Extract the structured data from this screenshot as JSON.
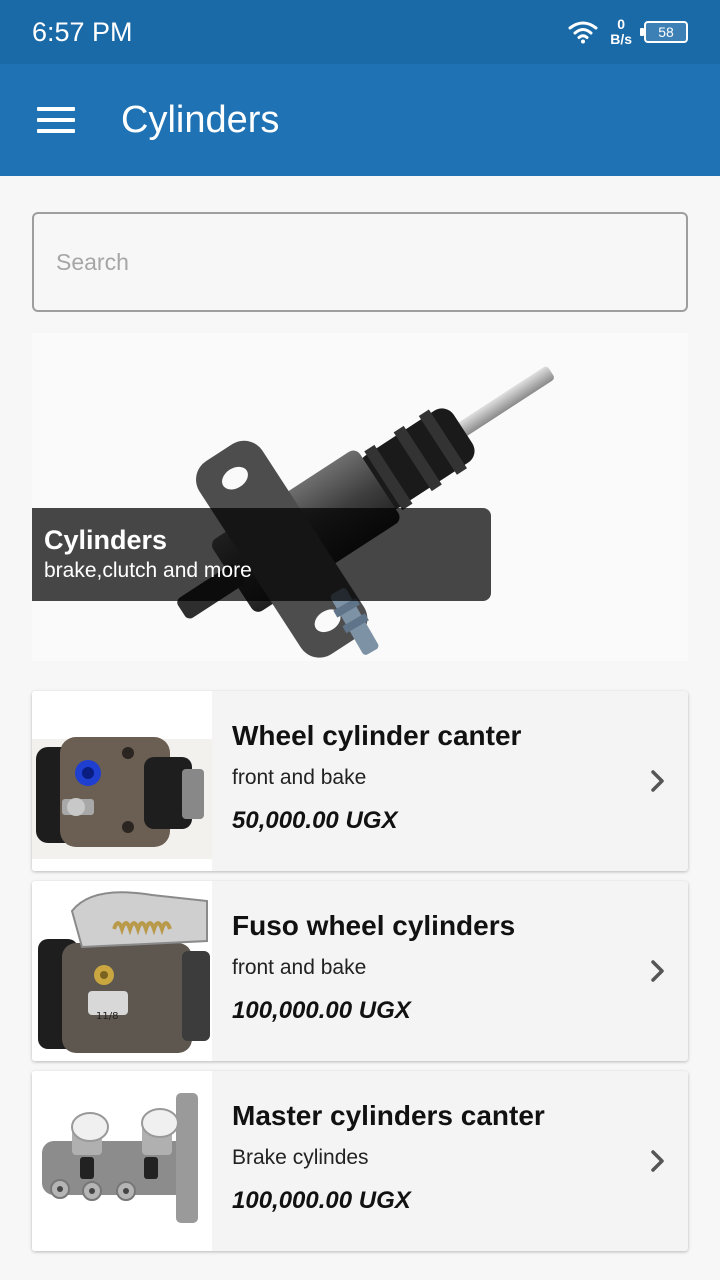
{
  "status_bar": {
    "time": "6:57 PM",
    "net_speed_value": "0",
    "net_speed_unit": "B/s",
    "battery": "58"
  },
  "app_bar": {
    "title": "Cylinders"
  },
  "search": {
    "placeholder": "Search",
    "value": ""
  },
  "hero": {
    "title": "Cylinders",
    "subtitle": "brake,clutch and more"
  },
  "products": [
    {
      "name": "Wheel cylinder canter",
      "description": "front and bake",
      "price": "50,000.00 UGX"
    },
    {
      "name": "Fuso wheel cylinders",
      "description": "front and bake",
      "price": "100,000.00 UGX"
    },
    {
      "name": "Master cylinders canter",
      "description": "Brake cylindes",
      "price": "100,000.00 UGX"
    }
  ],
  "colors": {
    "status_bar": "#1b6aa8",
    "app_bar": "#1f73b5",
    "background": "#f7f7f7"
  },
  "icons": [
    "wifi-icon",
    "battery-icon",
    "menu-icon",
    "chevron-right-icon"
  ]
}
